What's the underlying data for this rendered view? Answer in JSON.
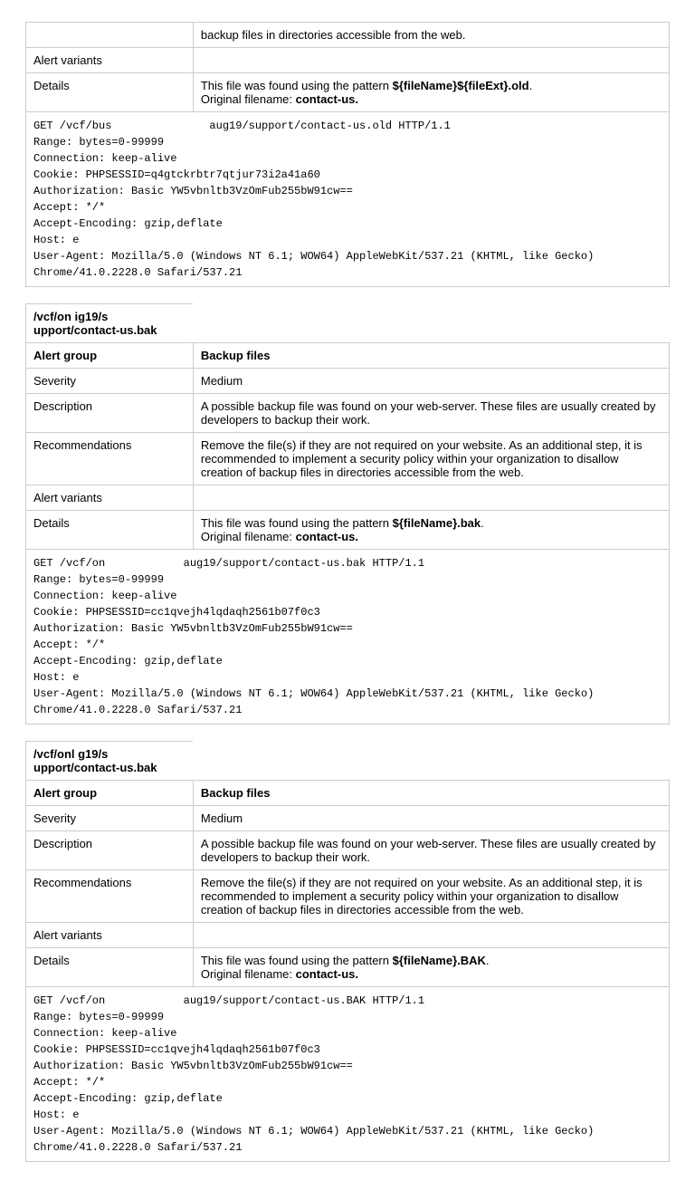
{
  "partial": {
    "row1_value": "backup files in directories accessible from the web.",
    "alert_variants_label": "Alert variants",
    "details_label": "Details",
    "details_prefix": "This file was found using the pattern ",
    "details_pattern": "${fileName}${fileExt}.old",
    "details_suffix": ".",
    "details_line2_prefix": "Original filename: ",
    "details_line2_bold": "contact-us.",
    "request": "GET /vcf/bus               aug19/support/contact-us.old HTTP/1.1\nRange: bytes=0-99999\nConnection: keep-alive\nCookie: PHPSESSID=q4gtckrbtr7qtjur73i2a41a60\nAuthorization: Basic YW5vbnltb3VzOmFub255bW91cw==\nAccept: */*\nAccept-Encoding: gzip,deflate\nHost: e\nUser-Agent: Mozilla/5.0 (Windows NT 6.1; WOW64) AppleWebKit/537.21 (KHTML, like Gecko) Chrome/41.0.2228.0 Safari/537.21"
  },
  "blocks": [
    {
      "path": "/vcf/on              ig19/s\nupport/contact-us.bak",
      "alert_group_label": "Alert group",
      "alert_group_value": "Backup files",
      "severity_label": "Severity",
      "severity_value": "Medium",
      "description_label": "Description",
      "description_value": "A possible backup file was found on your web-server. These files are usually created by developers to backup their work.",
      "recommendations_label": "Recommendations",
      "recommendations_value": "Remove the file(s) if they are not required on your website. As an additional step, it is recommended to implement a security policy within your organization to disallow creation of backup files in directories accessible from the web.",
      "alert_variants_label": "Alert variants",
      "details_label": "Details",
      "details_prefix": "This file was found using the pattern ",
      "details_pattern": "${fileName}.bak",
      "details_suffix": ".",
      "details_line2_prefix": "Original filename: ",
      "details_line2_bold": "contact-us.",
      "request": "GET /vcf/on            aug19/support/contact-us.bak HTTP/1.1\nRange: bytes=0-99999\nConnection: keep-alive\nCookie: PHPSESSID=cc1qvejh4lqdaqh2561b07f0c3\nAuthorization: Basic YW5vbnltb3VzOmFub255bW91cw==\nAccept: */*\nAccept-Encoding: gzip,deflate\nHost: e\nUser-Agent: Mozilla/5.0 (Windows NT 6.1; WOW64) AppleWebKit/537.21 (KHTML, like Gecko) Chrome/41.0.2228.0 Safari/537.21"
    },
    {
      "path": "/vcf/onl             g19/s\nupport/contact-us.bak",
      "alert_group_label": "Alert group",
      "alert_group_value": "Backup files",
      "severity_label": "Severity",
      "severity_value": "Medium",
      "description_label": "Description",
      "description_value": "A possible backup file was found on your web-server. These files are usually created by developers to backup their work.",
      "recommendations_label": "Recommendations",
      "recommendations_value": "Remove the file(s) if they are not required on your website. As an additional step, it is recommended to implement a security policy within your organization to disallow creation of backup files in directories accessible from the web.",
      "alert_variants_label": "Alert variants",
      "details_label": "Details",
      "details_prefix": "This file was found using the pattern ",
      "details_pattern": "${fileName}.BAK",
      "details_suffix": ".",
      "details_line2_prefix": "Original filename: ",
      "details_line2_bold": "contact-us.",
      "request": "GET /vcf/on            aug19/support/contact-us.BAK HTTP/1.1\nRange: bytes=0-99999\nConnection: keep-alive\nCookie: PHPSESSID=cc1qvejh4lqdaqh2561b07f0c3\nAuthorization: Basic YW5vbnltb3VzOmFub255bW91cw==\nAccept: */*\nAccept-Encoding: gzip,deflate\nHost: e\nUser-Agent: Mozilla/5.0 (Windows NT 6.1; WOW64) AppleWebKit/537.21 (KHTML, like Gecko) Chrome/41.0.2228.0 Safari/537.21"
    }
  ]
}
